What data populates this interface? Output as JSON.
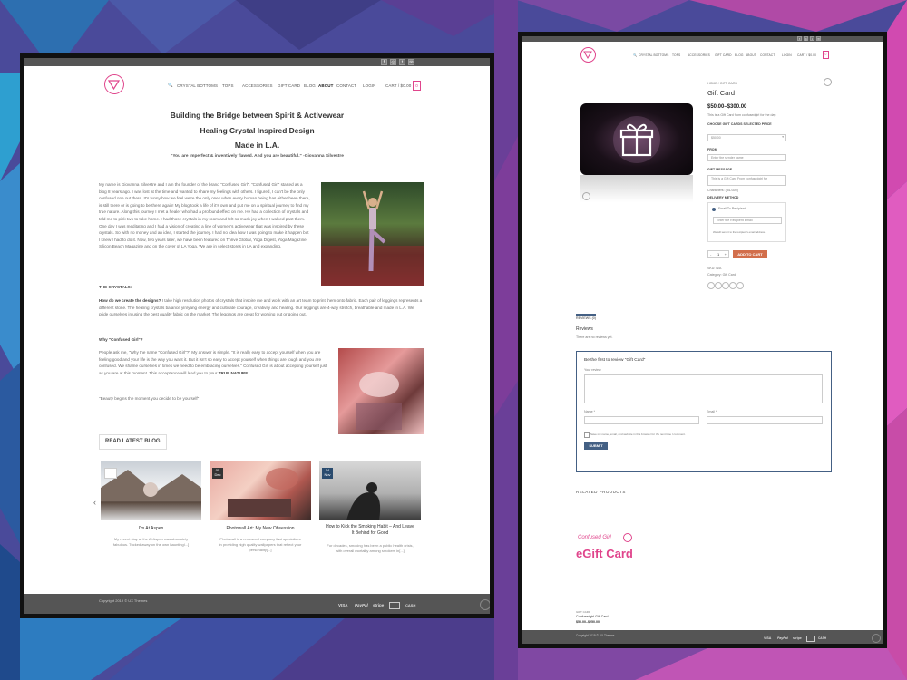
{
  "colors": {
    "accent": "#e0458c",
    "footer": "#555555",
    "cart_button": "#d26e4b",
    "submit_button": "#446084"
  },
  "left": {
    "nav": {
      "items": [
        "CRYSTAL BOTTOMS",
        "TOPS",
        "ACCESSORIES",
        "GIFT CARD",
        "BLOG",
        "ABOUT",
        "CONTACT"
      ],
      "login": "LOGIN",
      "cart": "CART / $0.00",
      "cart_count": "0"
    },
    "headings": {
      "line1": "Building the Bridge between Spirit & Activewear",
      "line2": "Healing Crystal Inspired Design",
      "line3": "Made in L.A.",
      "quote": "\"You are imperfect & inventively flawed. And you are beautiful.\" -Giovanna Silvestre"
    },
    "intro": "My name is Giovanna Silvestre and I am the founder of the brand \"Confused Girl\". \"Confused Girl\" started as a blog 8 years ago. I was lost at the time and wanted to share my feelings with others. I figured, I can't be the only confused one out there. It's funny how we feel we're the only ones when every human being has either been there, is still there or is going to be there again! My blog took a life of it's own and put me on a spiritual journey to find my true nature. Along this journey I met a healer who had a profound effect on me. He had a collection of crystals and told me to pick two to take home. I had those crystals in my room and felt so much joy when I walked past them. One day I was meditating and I had a vision of creating a line of women's activewear that was inspired by these crystals. So with no money and an idea, I started the journey. I had no idea how I was going to make it happen but I knew I had to do it. Now, two years later, we have been featured on Thrive Global, Yoga Digest, Yoga Magazine, Silicon Beach Magazine and on the cover of LA Yoga. We are in select stores in LA and expanding.",
    "crystals_heading": "THE CRYSTALS:",
    "crystals_lead": "How do we create the designs?",
    "crystals_text": "I take high resolution photos of crystals that inspire me and work with an art team to print them onto fabric. Each pair of leggings represents a different stone. The healing crystals balance yin/yang energy and cultivate courage, creativity and healing. Our leggings are 4-way stretch, breathable and made in L.A. We pride ourselves in using the best quality fabric on the market. The leggings are great for working out or going out.",
    "why_heading": "Why \"Confused Girl\"?",
    "why_text": "People ask me, \"Why the name \"Confused Girl\"?\" My answer is simple. \"It is really easy to accept yourself when you are feeling good and your life is the way you want it. But it isn't so easy to accept yourself when things are tough and you are confused. We shame ourselves in times we need to be embracing ourselves.\" Confused Girl is about accepting yourself just as you are at this moment. This acceptance will lead you to your",
    "why_bold": "TRUE NATURE.",
    "beauty_quote": "\"Beauty begins the moment you decide to be yourself\"",
    "blog_heading": "READ LATEST BLOG",
    "posts": [
      {
        "title": "I'm At Aspen",
        "desc": "My recent stay at the At Aspen was absolutely fabulous. Tucked away on the own hauntingl...]",
        "day": "",
        "month": ""
      },
      {
        "title": "Photowall Art: My New Obsession",
        "desc": "Photowall is a renowned company that specializes in providing high quality wallpapers that reflect your personality[...]",
        "day": "05",
        "month": "Dec"
      },
      {
        "title": "How to Kick the Smoking Habit – And Leave It Behind for Good",
        "desc": "For decades, smoking has been a public health crisis, with overall mortality among smokers in[...]",
        "day": "14",
        "month": "Nov"
      }
    ],
    "copyright": "Copyright 2019 © UX Themes",
    "payments": [
      "VISA",
      "PayPal",
      "stripe",
      "CASH",
      ""
    ]
  },
  "right": {
    "nav": {
      "items": [
        "CRYSTAL BOTTOMS",
        "TOPS",
        "ACCESSORIES",
        "GIFT CARD",
        "BLOG",
        "ABOUT",
        "CONTACT"
      ],
      "login": "LOGIN",
      "cart": "CART / $0.00",
      "cart_count": "0"
    },
    "breadcrumb": "HOME / GIFT CARD",
    "title": "Gift Card",
    "price": "$50.00–$300.00",
    "subtitle": "This is a Gift Card from confusedgirl for the day.",
    "choose_label": "CHOOSE GIFT CARDS SELECTED PRICE",
    "price_select": "$50.00",
    "from_label": "FROM",
    "from_placeholder": "Enter the sender name",
    "message_label": "GIFT MESSAGE",
    "message_value": "This is a Gift Card From confusedgirl for",
    "char_count": "Characters: ( 51/300)",
    "delivery_label": "DELIVERY METHOD",
    "delivery_option": "Email To Recipient",
    "recipient_placeholder": "Enter the Recipient Email",
    "delivery_note": "We will send it to the recipient's email address.",
    "qty": "1",
    "add_to_cart": "ADD TO CART",
    "sku": "SKU: N/A",
    "category": "Category: Gift Card",
    "tab": "REVIEWS (0)",
    "reviews_heading": "Reviews",
    "no_reviews": "There are no reviews yet.",
    "review_title": "Be the first to review \"Gift Card\"",
    "your_review": "Your review",
    "name_label": "Name *",
    "email_label": "Email *",
    "save_info": "Save my name, email, and website in this browser for the next time I comment.",
    "submit": "SUBMIT",
    "related": "RELATED PRODUCTS",
    "related_brand": "Confused Girl",
    "related_product_label": "eGift Card",
    "related_cat": "GIFT CARD",
    "related_name": "Confusedgirl Gift Card",
    "related_price": "$50.00–$250.00",
    "copyright": "Copyright 2019 © UX Themes",
    "payments": [
      "VISA",
      "PayPal",
      "stripe",
      "CASH",
      ""
    ]
  }
}
